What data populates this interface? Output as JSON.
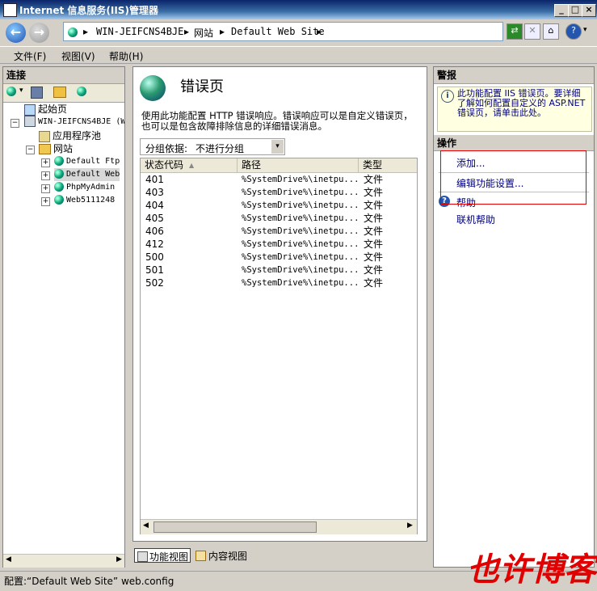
{
  "window": {
    "title": "Internet 信息服务(IIS)管理器"
  },
  "address": {
    "crumbs": [
      "WIN-JEIFCNS4BJE",
      "网站",
      "Default Web Site"
    ]
  },
  "menu": [
    "文件(F)",
    "视图(V)",
    "帮助(H)"
  ],
  "connections": {
    "header": "连接",
    "tree": [
      {
        "label": "起始页"
      },
      {
        "label": "WIN-JEIFCNS4BJE (W"
      },
      {
        "label": "应用程序池"
      },
      {
        "label": "网站"
      },
      {
        "label": "Default Ftp"
      },
      {
        "label": "Default Web"
      },
      {
        "label": "PhpMyAdmin"
      },
      {
        "label": "Web5111248"
      }
    ]
  },
  "main": {
    "title": "错误页",
    "description": "使用此功能配置 HTTP 错误响应。错误响应可以是自定义错误页，也可以是包含故障排除信息的详细错误消息。",
    "group_label": "分组依据:",
    "group_value": "不进行分组",
    "columns": [
      "状态代码",
      "路径",
      "类型"
    ],
    "rows": [
      {
        "code": "401",
        "path": "%SystemDrive%\\inetpu...",
        "type": "文件"
      },
      {
        "code": "403",
        "path": "%SystemDrive%\\inetpu...",
        "type": "文件"
      },
      {
        "code": "404",
        "path": "%SystemDrive%\\inetpu...",
        "type": "文件"
      },
      {
        "code": "405",
        "path": "%SystemDrive%\\inetpu...",
        "type": "文件"
      },
      {
        "code": "406",
        "path": "%SystemDrive%\\inetpu...",
        "type": "文件"
      },
      {
        "code": "412",
        "path": "%SystemDrive%\\inetpu...",
        "type": "文件"
      },
      {
        "code": "500",
        "path": "%SystemDrive%\\inetpu...",
        "type": "文件"
      },
      {
        "code": "501",
        "path": "%SystemDrive%\\inetpu...",
        "type": "文件"
      },
      {
        "code": "502",
        "path": "%SystemDrive%\\inetpu...",
        "type": "文件"
      }
    ],
    "view_tabs": [
      "功能视图",
      "内容视图"
    ]
  },
  "alerts": {
    "header": "警报",
    "text": "此功能配置 IIS 错误页。要详细了解如何配置自定义的 ASP.NET 错误页，请单击此处。"
  },
  "actions": {
    "header": "操作",
    "add": "添加...",
    "edit_settings": "编辑功能设置...",
    "help": "帮助",
    "online_help": "联机帮助"
  },
  "statusbar": {
    "text": "配置:“Default Web Site” web.config"
  },
  "watermark": {
    "text": "也许博客"
  },
  "colors": {
    "highlight_box": "#e00000",
    "link": "#000080",
    "title_bar": "#0a246a"
  }
}
